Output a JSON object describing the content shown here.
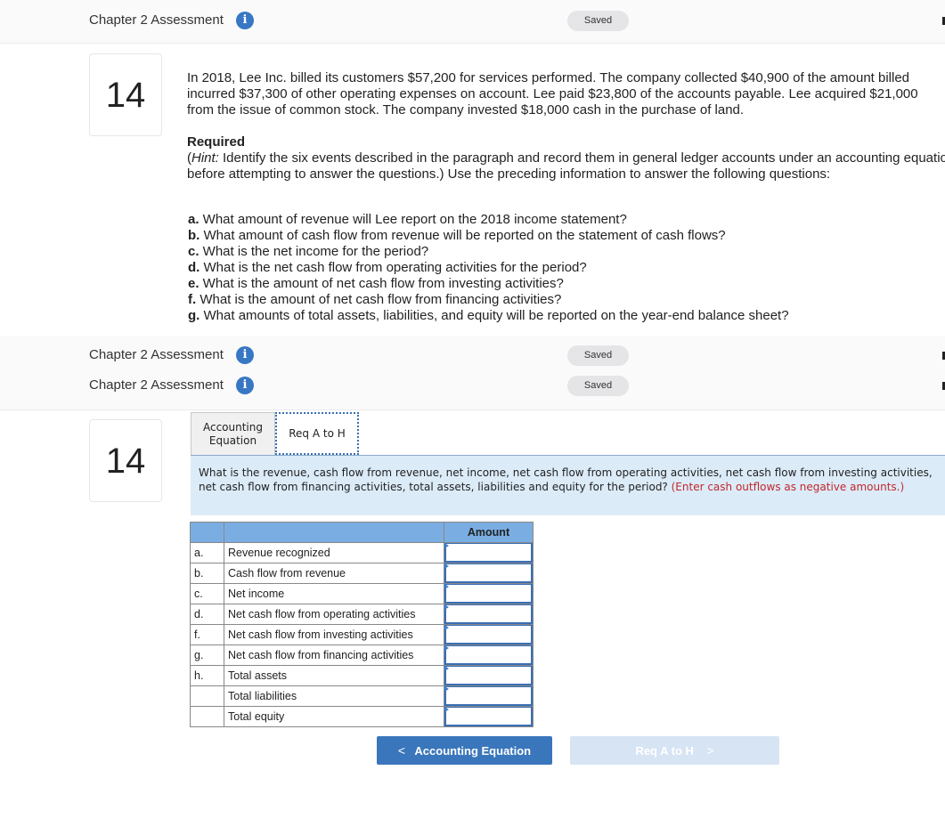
{
  "header_rows": [
    {
      "title": "Chapter 2 Assessment",
      "status": "Saved"
    },
    {
      "title": "Chapter 2 Assessment",
      "status": "Saved"
    },
    {
      "title": "Chapter 2 Assessment",
      "status": "Saved"
    }
  ],
  "info_icon_glyph": "i",
  "question_number": "14",
  "problem": {
    "line1": "In 2018, Lee Inc. billed its customers $57,200 for services performed. The company collected $40,900 of the amount billed",
    "line2": "incurred $37,300 of other operating expenses on account. Lee paid $23,800 of the accounts payable. Lee acquired $21,000",
    "line3": "from the issue of common stock. The company invested $18,000 cash in the purchase of land.",
    "required_title": "Required",
    "hint_label": "Hint:",
    "hint_line1": " Identify the six events described in the paragraph and record them in general ledger accounts under an accounting equation",
    "hint_line2": "before attempting to answer the questions.) Use the preceding information to answer the following questions:"
  },
  "questions": [
    {
      "letter": "a.",
      "text": " What amount of revenue will Lee report on the 2018 income statement?"
    },
    {
      "letter": "b.",
      "text": " What amount of cash flow from revenue will be reported on the statement of cash flows?"
    },
    {
      "letter": "c.",
      "text": " What is the net income for the period?"
    },
    {
      "letter": "d.",
      "text": " What is the net cash flow from operating activities for the period?"
    },
    {
      "letter": "e.",
      "text": " What is the amount of net cash flow from investing activities?"
    },
    {
      "letter": "f.",
      "text": " What is the amount of net cash flow from financing activities?"
    },
    {
      "letter": "g.",
      "text": " What amounts of total assets, liabilities, and equity will be reported on the year-end balance sheet?"
    }
  ],
  "tabs": {
    "accounting_equation_line1": "Accounting",
    "accounting_equation_line2": "Equation",
    "req_a_to_h": "Req A to H"
  },
  "prompt": {
    "text": "What is the revenue, cash flow from revenue, net income, net cash flow from operating activities, net cash flow from investing activities, net cash flow from financing activities, total assets, liabilities and equity for the period? ",
    "instruction": "(Enter cash outflows as negative amounts.)"
  },
  "answer_table": {
    "amount_header": "Amount",
    "rows": [
      {
        "letter": "a.",
        "label": "Revenue recognized",
        "value": ""
      },
      {
        "letter": "b.",
        "label": "Cash flow from revenue",
        "value": ""
      },
      {
        "letter": "c.",
        "label": "Net income",
        "value": ""
      },
      {
        "letter": "d.",
        "label": "Net cash flow from operating activities",
        "value": ""
      },
      {
        "letter": "f.",
        "label": "Net cash flow from investing activities",
        "value": ""
      },
      {
        "letter": "g.",
        "label": "Net cash flow from financing activities",
        "value": ""
      },
      {
        "letter": "h.",
        "label": "Total assets",
        "value": ""
      },
      {
        "letter": "",
        "label": "Total liabilities",
        "value": ""
      },
      {
        "letter": "",
        "label": "Total equity",
        "value": ""
      }
    ]
  },
  "nav": {
    "prev_label": "Accounting Equation",
    "next_label": "Req A to H",
    "prev_glyph": "<",
    "next_glyph": ">"
  },
  "colors": {
    "accent": "#3a76bb",
    "info_icon": "#3877c4",
    "prompt_bg": "#dcebf8",
    "table_header": "#7aaee3",
    "warning_text": "#c0282d",
    "disabled_button": "#d7e4f3"
  }
}
